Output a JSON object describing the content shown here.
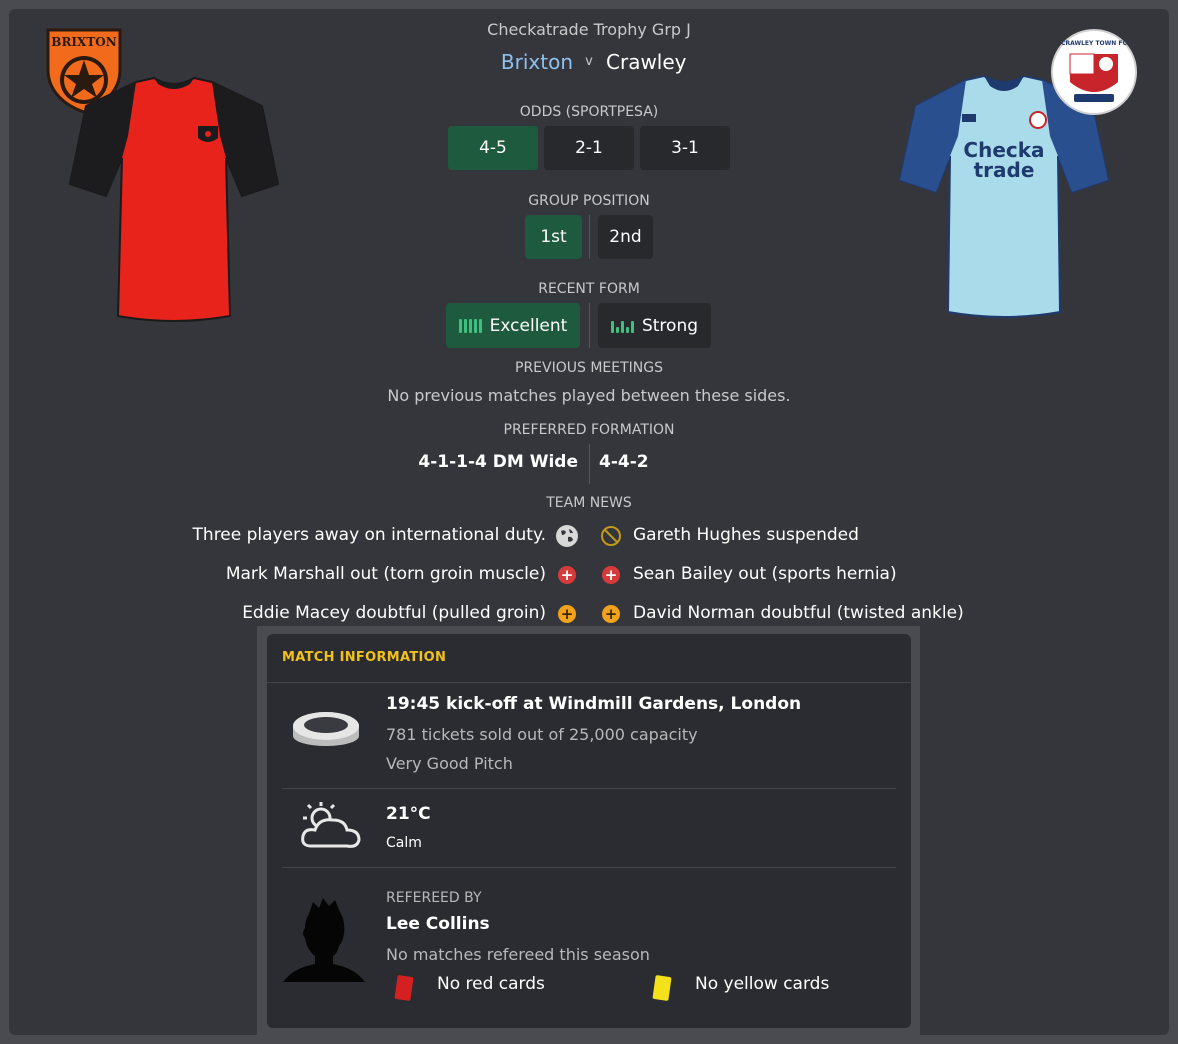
{
  "header": {
    "competition": "Checkatrade Trophy Grp J",
    "home_team": "Brixton",
    "versus": "v",
    "away_team": "Crawley",
    "home_badge_text": "BRIXTON",
    "away_badge_text": "CRAWLEY TOWN FC",
    "away_kit_sponsor": "Checka trade"
  },
  "odds": {
    "title": "ODDS (SPORTPESA)",
    "home": "4-5",
    "draw": "2-1",
    "away": "3-1"
  },
  "group_position": {
    "title": "GROUP POSITION",
    "home": "1st",
    "away": "2nd"
  },
  "recent_form": {
    "title": "RECENT FORM",
    "home": "Excellent",
    "away": "Strong",
    "home_level": [
      5,
      5,
      5,
      5,
      5
    ],
    "away_level": [
      4,
      2,
      4,
      2,
      4
    ]
  },
  "previous_meetings": {
    "title": "PREVIOUS MEETINGS",
    "text": "No previous matches played between these sides."
  },
  "formation": {
    "title": "PREFERRED FORMATION",
    "home": "4-1-1-4 DM Wide",
    "away": "4-4-2"
  },
  "team_news": {
    "title": "TEAM NEWS",
    "home": [
      {
        "text": "Three players away on international duty.",
        "icon": "globe-icon"
      },
      {
        "text": "Mark Marshall out (torn groin muscle)",
        "icon": "injury-icon"
      },
      {
        "text": "Eddie Macey doubtful (pulled groin)",
        "icon": "doubtful-icon"
      }
    ],
    "away": [
      {
        "text": "Gareth Hughes suspended",
        "icon": "suspended-icon"
      },
      {
        "text": "Sean Bailey out (sports hernia)",
        "icon": "injury-icon"
      },
      {
        "text": "David Norman doubtful (twisted ankle)",
        "icon": "doubtful-icon"
      }
    ]
  },
  "match_info": {
    "title": "MATCH INFORMATION",
    "venue": "19:45 kick-off at Windmill Gardens, London",
    "tickets": "781 tickets sold out of 25,000 capacity",
    "pitch": "Very Good Pitch",
    "temperature": "21°C",
    "wind": "Calm",
    "referee_label": "REFEREED BY",
    "referee_name": "Lee Collins",
    "referee_stats": "No matches refereed this season",
    "red_cards": "No red cards",
    "yellow_cards": "No yellow cards"
  },
  "colors": {
    "accent_green": "#1d5a3e",
    "home_name": "#8fc1f0",
    "section_gold": "#f2c21b",
    "home_kit": "#e8231c",
    "away_kit": "#a9dbea"
  }
}
